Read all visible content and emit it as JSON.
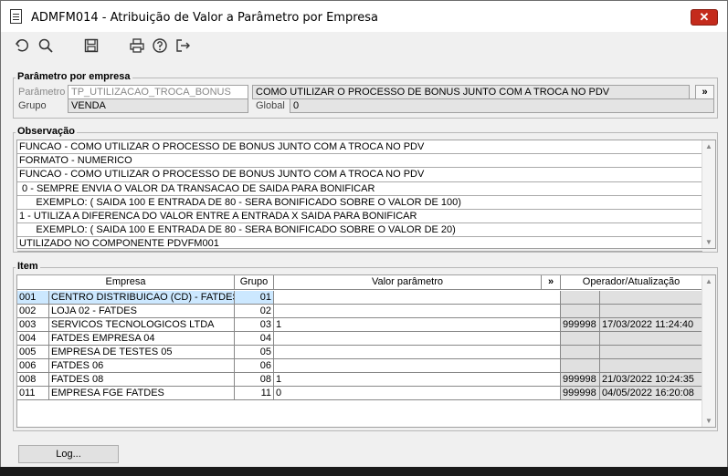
{
  "window": {
    "title": "ADMFM014 - Atribuição de Valor a Parâmetro por Empresa",
    "close_label": "✕"
  },
  "toolbar": {
    "icons": [
      "undo-icon",
      "search-icon",
      "save-icon",
      "print-icon",
      "help-icon",
      "exit-icon"
    ]
  },
  "parametro_group": {
    "title": "Parâmetro por empresa",
    "parametro_label": "Parâmetro",
    "parametro_value": "TP_UTILIZACAO_TROCA_BONUS",
    "descricao_value": "COMO UTILIZAR O PROCESSO DE BONUS JUNTO COM A TROCA NO PDV",
    "more_label": "»",
    "grupo_label": "Grupo",
    "grupo_value": "VENDA",
    "global_label": "Global",
    "global_value": "0"
  },
  "observacao_group": {
    "title": "Observação",
    "lines": [
      "FUNCAO - COMO UTILIZAR O PROCESSO DE BONUS JUNTO COM A TROCA NO PDV",
      "FORMATO - NUMERICO",
      "FUNCAO - COMO UTILIZAR O PROCESSO DE BONUS JUNTO COM A TROCA NO PDV",
      " 0 - SEMPRE ENVIA O VALOR DA TRANSACAO DE SAIDA PARA BONIFICAR",
      "      EXEMPLO: ( SAIDA 100 E ENTRADA DE 80 - SERA BONIFICADO SOBRE O VALOR DE 100)",
      "1 - UTILIZA A DIFERENCA DO VALOR ENTRE A ENTRADA X SAIDA PARA BONIFICAR",
      "      EXEMPLO: ( SAIDA 100 E ENTRADA DE 80 - SERA BONIFICADO SOBRE O VALOR DE 20)",
      "UTILIZADO NO COMPONENTE PDVFM001"
    ]
  },
  "item_group": {
    "title": "Item",
    "headers": {
      "empresa": "Empresa",
      "grupo": "Grupo",
      "valor": "Valor parâmetro",
      "more": "»",
      "operador": "Operador/Atualização"
    },
    "rows": [
      {
        "cod": "001",
        "nome": "CENTRO DISTRIBUICAO (CD) - FATDES",
        "grupo": "01",
        "valor": "",
        "operador": "",
        "data": ""
      },
      {
        "cod": "002",
        "nome": "LOJA 02 - FATDES",
        "grupo": "02",
        "valor": "",
        "operador": "",
        "data": ""
      },
      {
        "cod": "003",
        "nome": "SERVICOS TECNOLOGICOS LTDA",
        "grupo": "03",
        "valor": "1",
        "operador": "999998",
        "data": "17/03/2022 11:24:40"
      },
      {
        "cod": "004",
        "nome": "FATDES EMPRESA 04",
        "grupo": "04",
        "valor": "",
        "operador": "",
        "data": ""
      },
      {
        "cod": "005",
        "nome": "EMPRESA DE TESTES 05",
        "grupo": "05",
        "valor": "",
        "operador": "",
        "data": ""
      },
      {
        "cod": "006",
        "nome": "FATDES 06",
        "grupo": "06",
        "valor": "",
        "operador": "",
        "data": ""
      },
      {
        "cod": "008",
        "nome": "FATDES 08",
        "grupo": "08",
        "valor": "1",
        "operador": "999998",
        "data": "21/03/2022 10:24:35"
      },
      {
        "cod": "011",
        "nome": "EMPRESA FGE FATDES",
        "grupo": "11",
        "valor": "0",
        "operador": "999998",
        "data": "04/05/2022 16:20:08"
      }
    ]
  },
  "footer": {
    "log_label": "Log..."
  }
}
